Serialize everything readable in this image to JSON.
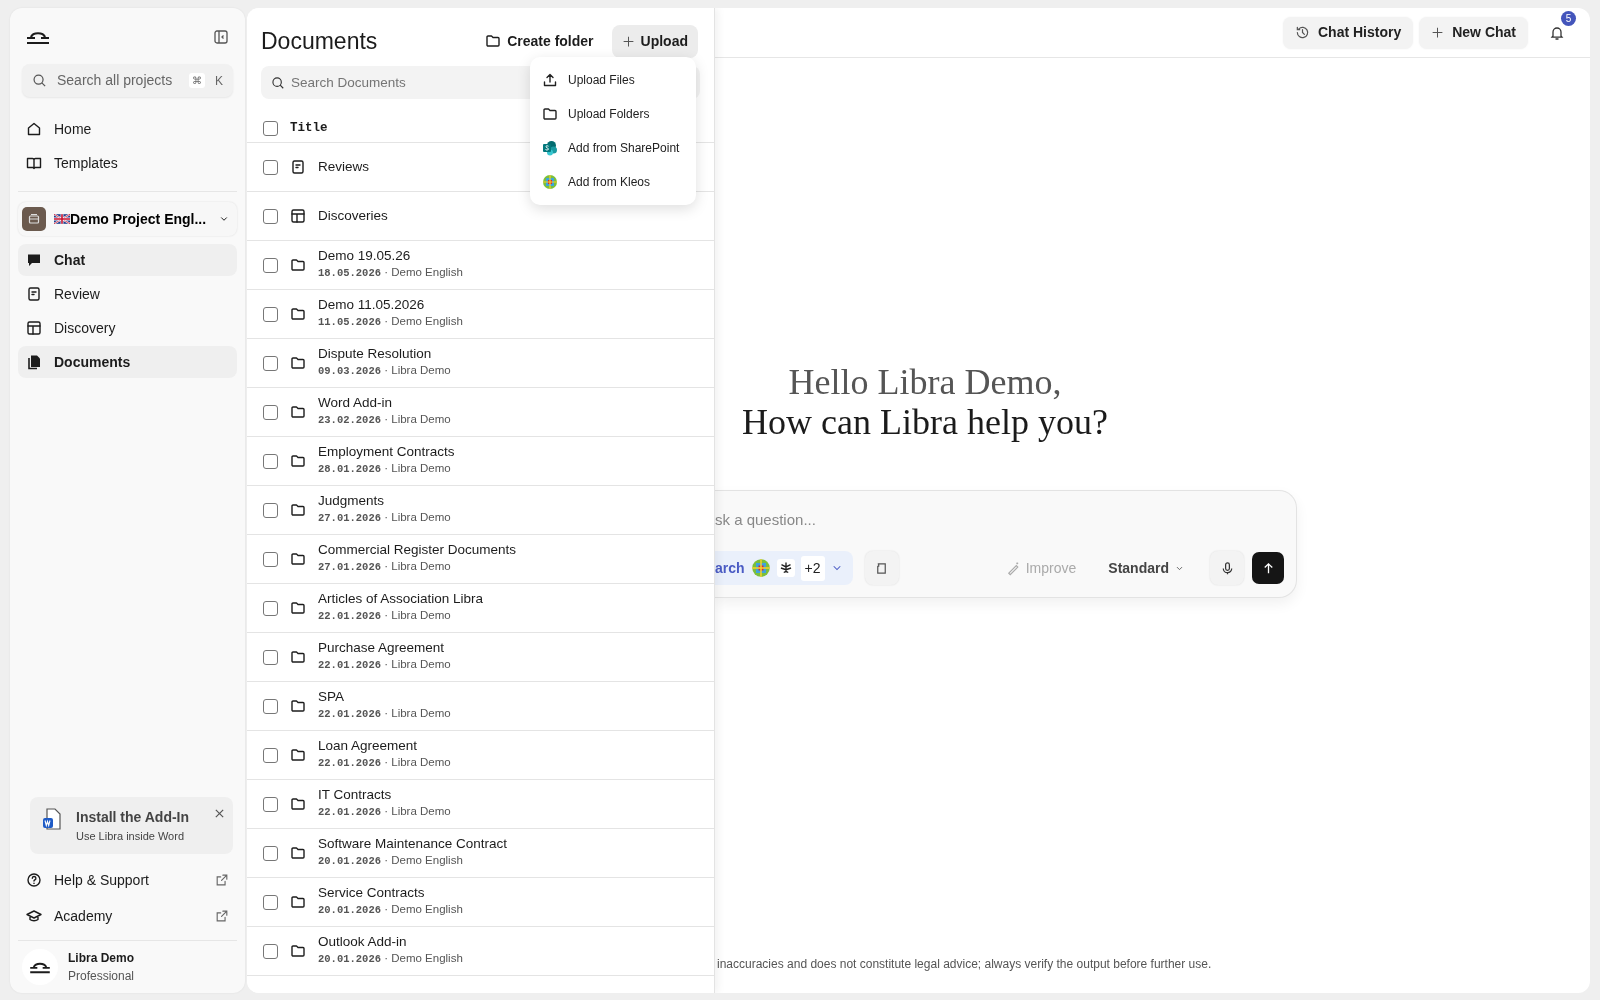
{
  "sidebar": {
    "search": {
      "placeholder": "Search all projects",
      "shortcut_symbol": "⌘",
      "shortcut_key": "K"
    },
    "top_items": [
      {
        "label": "Home"
      },
      {
        "label": "Templates"
      }
    ],
    "project": {
      "name": "Demo Project Engl..."
    },
    "project_items": [
      {
        "label": "Chat",
        "selected": true
      },
      {
        "label": "Review",
        "selected": false
      },
      {
        "label": "Discovery",
        "selected": false
      },
      {
        "label": "Documents",
        "selected": true
      }
    ],
    "addin": {
      "title": "Install the Add-In",
      "subtitle": "Use Libra inside Word"
    },
    "links": [
      {
        "label": "Help & Support"
      },
      {
        "label": "Academy"
      }
    ],
    "user": {
      "name": "Libra Demo",
      "plan": "Professional"
    }
  },
  "documents": {
    "title": "Documents",
    "create_folder": "Create folder",
    "upload": "Upload",
    "search_placeholder": "Search Documents",
    "column_title": "Title",
    "header_checked": false,
    "rows": [
      {
        "kind": "review",
        "title": "Reviews",
        "checked": false
      },
      {
        "kind": "table",
        "title": "Discoveries",
        "checked": false
      },
      {
        "kind": "folder",
        "title": "Demo 19.05.26",
        "meta": "**18.05.2026** · Demo English",
        "checked": false
      },
      {
        "kind": "folder",
        "title": "Demo 11.05.2026",
        "meta": "**11.05.2026** · Demo English",
        "checked": false
      },
      {
        "kind": "folder",
        "title": "Dispute Resolution",
        "meta": "**09.03.2026** · Libra Demo",
        "checked": false
      },
      {
        "kind": "folder",
        "title": "Word Add-in",
        "meta": "**23.02.2026** · Libra Demo",
        "checked": false
      },
      {
        "kind": "folder",
        "title": "Employment Contracts",
        "meta": "**28.01.2026** · Libra Demo",
        "checked": false
      },
      {
        "kind": "folder",
        "title": "Judgments",
        "meta": "**27.01.2026** · Libra Demo",
        "checked": false
      },
      {
        "kind": "folder",
        "title": "Commercial Register Documents",
        "meta": "**27.01.2026** · Libra Demo",
        "checked": false
      },
      {
        "kind": "folder",
        "title": "Articles of Association Libra",
        "meta": "**22.01.2026** · Libra Demo",
        "checked": false
      },
      {
        "kind": "folder",
        "title": "Purchase Agreement",
        "meta": "**22.01.2026** · Libra Demo",
        "checked": false
      },
      {
        "kind": "folder",
        "title": "SPA",
        "meta": "**22.01.2026** · Libra Demo",
        "checked": false
      },
      {
        "kind": "folder",
        "title": "Loan Agreement",
        "meta": "**22.01.2026** · Libra Demo",
        "checked": false
      },
      {
        "kind": "folder",
        "title": "IT Contracts",
        "meta": "**22.01.2026** · Libra Demo",
        "checked": false
      },
      {
        "kind": "folder",
        "title": "Software Maintenance Contract",
        "meta": "**20.01.2026** · Demo English",
        "checked": false
      },
      {
        "kind": "folder",
        "title": "Service Contracts",
        "meta": "**20.01.2026** · Demo English",
        "checked": false
      },
      {
        "kind": "folder",
        "title": "Outlook Add-in",
        "meta": "**20.01.2026** · Demo English",
        "checked": false
      }
    ]
  },
  "upload_menu": [
    {
      "label": "Upload Files"
    },
    {
      "label": "Upload Folders"
    },
    {
      "label": "Add from SharePoint"
    },
    {
      "label": "Add from Kleos"
    }
  ],
  "topbar": {
    "history": "Chat History",
    "new_chat": "New Chat",
    "notifications": "5"
  },
  "greeting": [
    "Hello Libra Demo,",
    "How can Libra help you?"
  ],
  "composer": {
    "placeholder": "sk a question...",
    "source_label": "arch",
    "source_more": "+2",
    "improve": "Improve",
    "mode": "Standard"
  },
  "disclaimer": "inaccuracies and does not constitute legal advice; always verify the output before further use."
}
